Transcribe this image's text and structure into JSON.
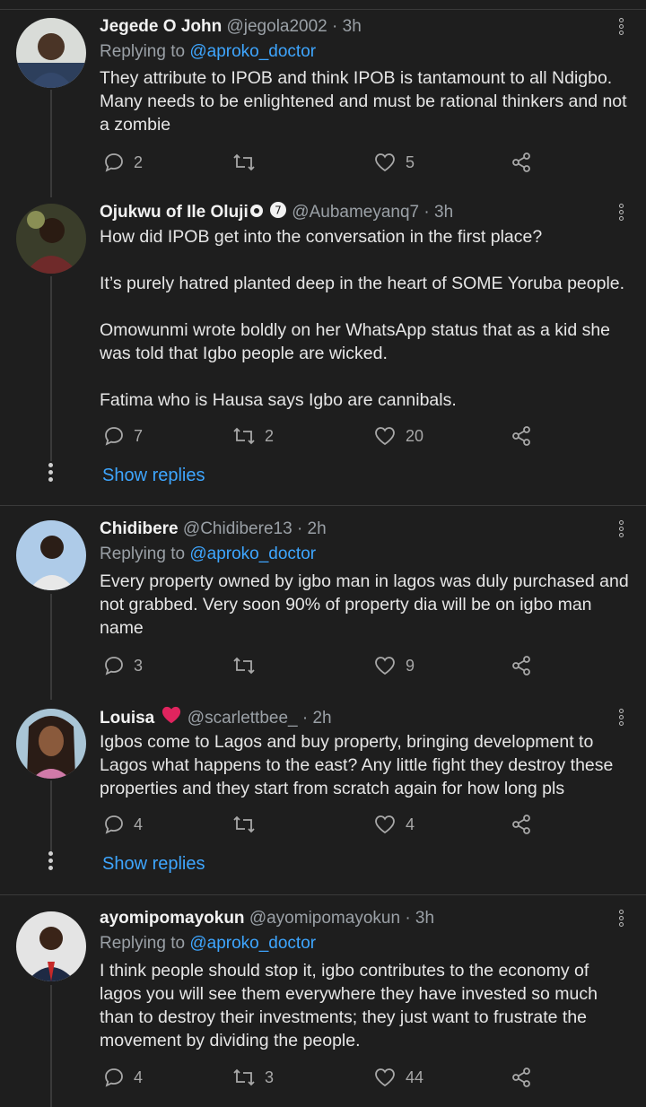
{
  "tweets": [
    {
      "name": "Jegede O John",
      "handle": "@jegola2002",
      "time": "3h",
      "replying_label": "Replying to",
      "replying_to": "@aproko_doctor",
      "body": [
        "They attribute to IPOB and think IPOB is tantamount to all Ndigbo. Many needs to be enlightened and must be rational thinkers and not a zombie"
      ],
      "replies": "2",
      "retweets": "",
      "likes": "5"
    },
    {
      "name": "Ojukwu of Ile Oluji",
      "handle": "@Aubameyanq7",
      "time": "3h",
      "body": [
        "How did IPOB get into the conversation in the first place?",
        "It’s purely hatred planted deep in the heart of SOME Yoruba people.",
        "Omowunmi wrote boldly on her WhatsApp status that as a kid she was told that Igbo people are wicked.",
        "Fatima who is Hausa says Igbo are cannibals."
      ],
      "replies": "7",
      "retweets": "2",
      "likes": "20",
      "show_replies": "Show replies"
    },
    {
      "name": "Chidibere",
      "handle": "@Chidibere13",
      "time": "2h",
      "replying_label": "Replying to",
      "replying_to": "@aproko_doctor",
      "body": [
        "Every property owned by igbo man in lagos was duly purchased and not  grabbed. Very soon 90% of property dia will be on igbo man name"
      ],
      "replies": "3",
      "retweets": "",
      "likes": "9"
    },
    {
      "name": "Louisa",
      "handle": "@scarlettbee_",
      "time": "2h",
      "body": [
        "Igbos come to Lagos and buy property, bringing development to Lagos what happens to the east? Any little fight they destroy these properties and they start from scratch again for how long pls"
      ],
      "replies": "4",
      "retweets": "",
      "likes": "4",
      "show_replies": "Show replies"
    },
    {
      "name": "ayomipomayokun",
      "handle": "@ayomipomayokun",
      "time": "3h",
      "replying_label": "Replying to",
      "replying_to": "@aproko_doctor",
      "body": [
        "I think people should stop it, igbo contributes to the economy of lagos you will see them everywhere they have invested so much than to destroy their investments; they just want to frustrate the movement by dividing the people."
      ],
      "replies": "4",
      "retweets": "3",
      "likes": "44"
    }
  ],
  "separator": "·",
  "colors": {
    "background": "#1e1e1e",
    "link": "#3ea6ff",
    "muted": "#9aa0a6",
    "heart": "#e0245e"
  },
  "icons": [
    "reply-icon",
    "retweet-icon",
    "like-icon",
    "share-icon",
    "more-icon",
    "heart-emoji-icon",
    "verified-icon"
  ]
}
